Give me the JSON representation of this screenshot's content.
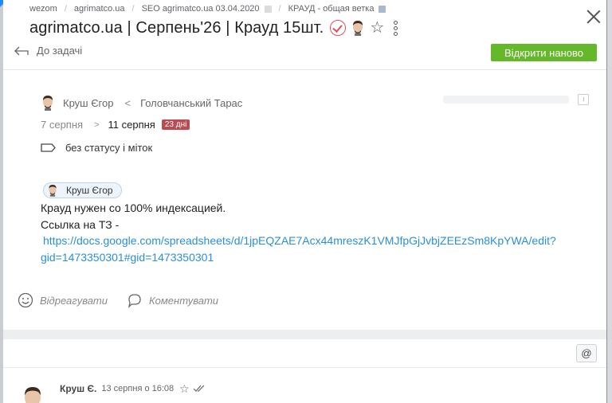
{
  "breadcrumb": {
    "items": [
      "wezom",
      "agrimatco.ua",
      "SEO agrimatco.ua 03.04.2020",
      "КРАУД - общая ветка"
    ],
    "separator": "/"
  },
  "task": {
    "title": "agrimatco.ua | Серпень'26 | Крауд 15шт.",
    "back_label": "До задачі",
    "reopen_label": "Відкрити наново"
  },
  "people": {
    "assignee": "Круш Єгор",
    "arrow": "<",
    "author": "Головчанський Тарас"
  },
  "dates": {
    "start": "7 серпня",
    "separator": ">",
    "end": "11 серпня",
    "duration_badge": "23 дні"
  },
  "status": {
    "label": "без статусу і міток"
  },
  "description": {
    "mention": "Круш Єгор",
    "line1": "Крауд нужен со 100% индексацией.",
    "line2": "Ссылка на ТЗ -",
    "link_part1": "https://docs.google.com/spreadsheets/d/1jpEQZAE7Acx44mreszK1VMJfpGjJvbjZEEzSm8KpYWA/edit?",
    "link_part2": "gid=1473350301#gid=1473350301"
  },
  "actions": {
    "react_label": "Відреагувати",
    "comment_label": "Коментувати"
  },
  "composer": {
    "mention_button": "@"
  },
  "comment": {
    "author": "Круш Є.",
    "time": "13 серпня о 16:08"
  },
  "colors": {
    "reopen_button": "#64b82a",
    "days_badge": "#b94b52",
    "link": "#2a8fd6",
    "check_badge": "#e0505e"
  },
  "icons": [
    "close-icon",
    "check-badge-icon",
    "avatar-icon",
    "star-icon",
    "more-vertical-icon",
    "back-arrow-icon",
    "calendar-icon",
    "tag-icon",
    "smile-icon",
    "comment-bubble-icon",
    "double-check-icon"
  ]
}
